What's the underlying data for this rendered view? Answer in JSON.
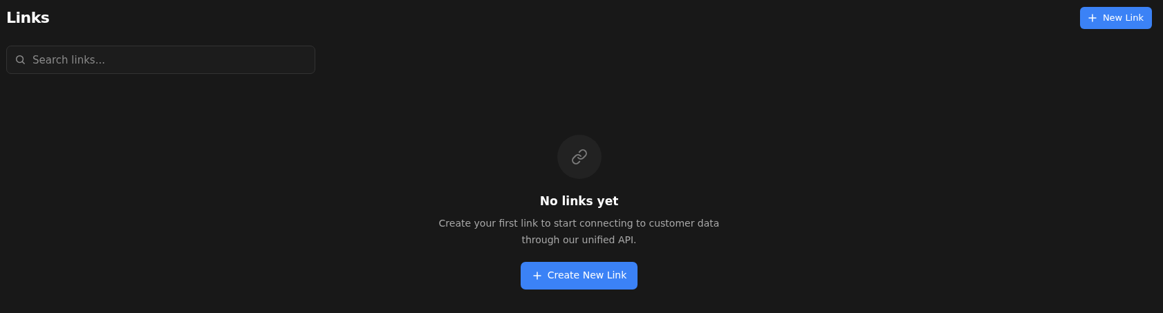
{
  "header": {
    "title": "Links",
    "button": "New Link"
  },
  "search": {
    "placeholder": "Search links..."
  },
  "empty_state": {
    "title": "No links yet",
    "description": "Create your first link to start connecting to customer data through our unified API.",
    "button": "Create New Link"
  }
}
